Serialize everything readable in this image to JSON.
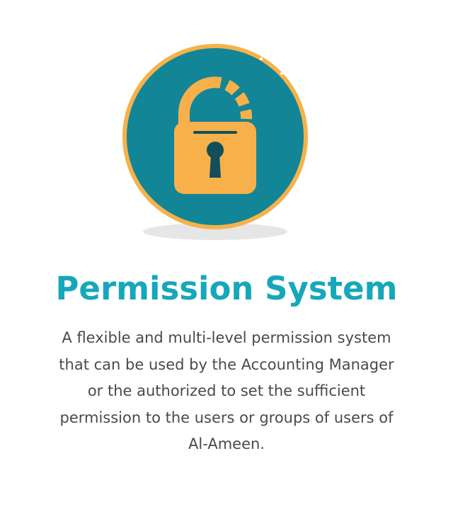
{
  "feature": {
    "icon": "padlock-icon",
    "title": "Permission System",
    "description_lines": [
      "A flexible and multi-level permission system",
      "that can be used by the Accounting Manager",
      "or the authorized to set the sufficient",
      "permission to the users or groups of users of",
      "Al-Ameen."
    ]
  },
  "colors": {
    "title": "#16a7bb",
    "circle_fill": "#128597",
    "circle_ring": "#f6b24a",
    "lock": "#f8b04b",
    "keyhole": "#124f5a",
    "shadow": "#e6e6e6",
    "text": "#4a4a4a"
  }
}
